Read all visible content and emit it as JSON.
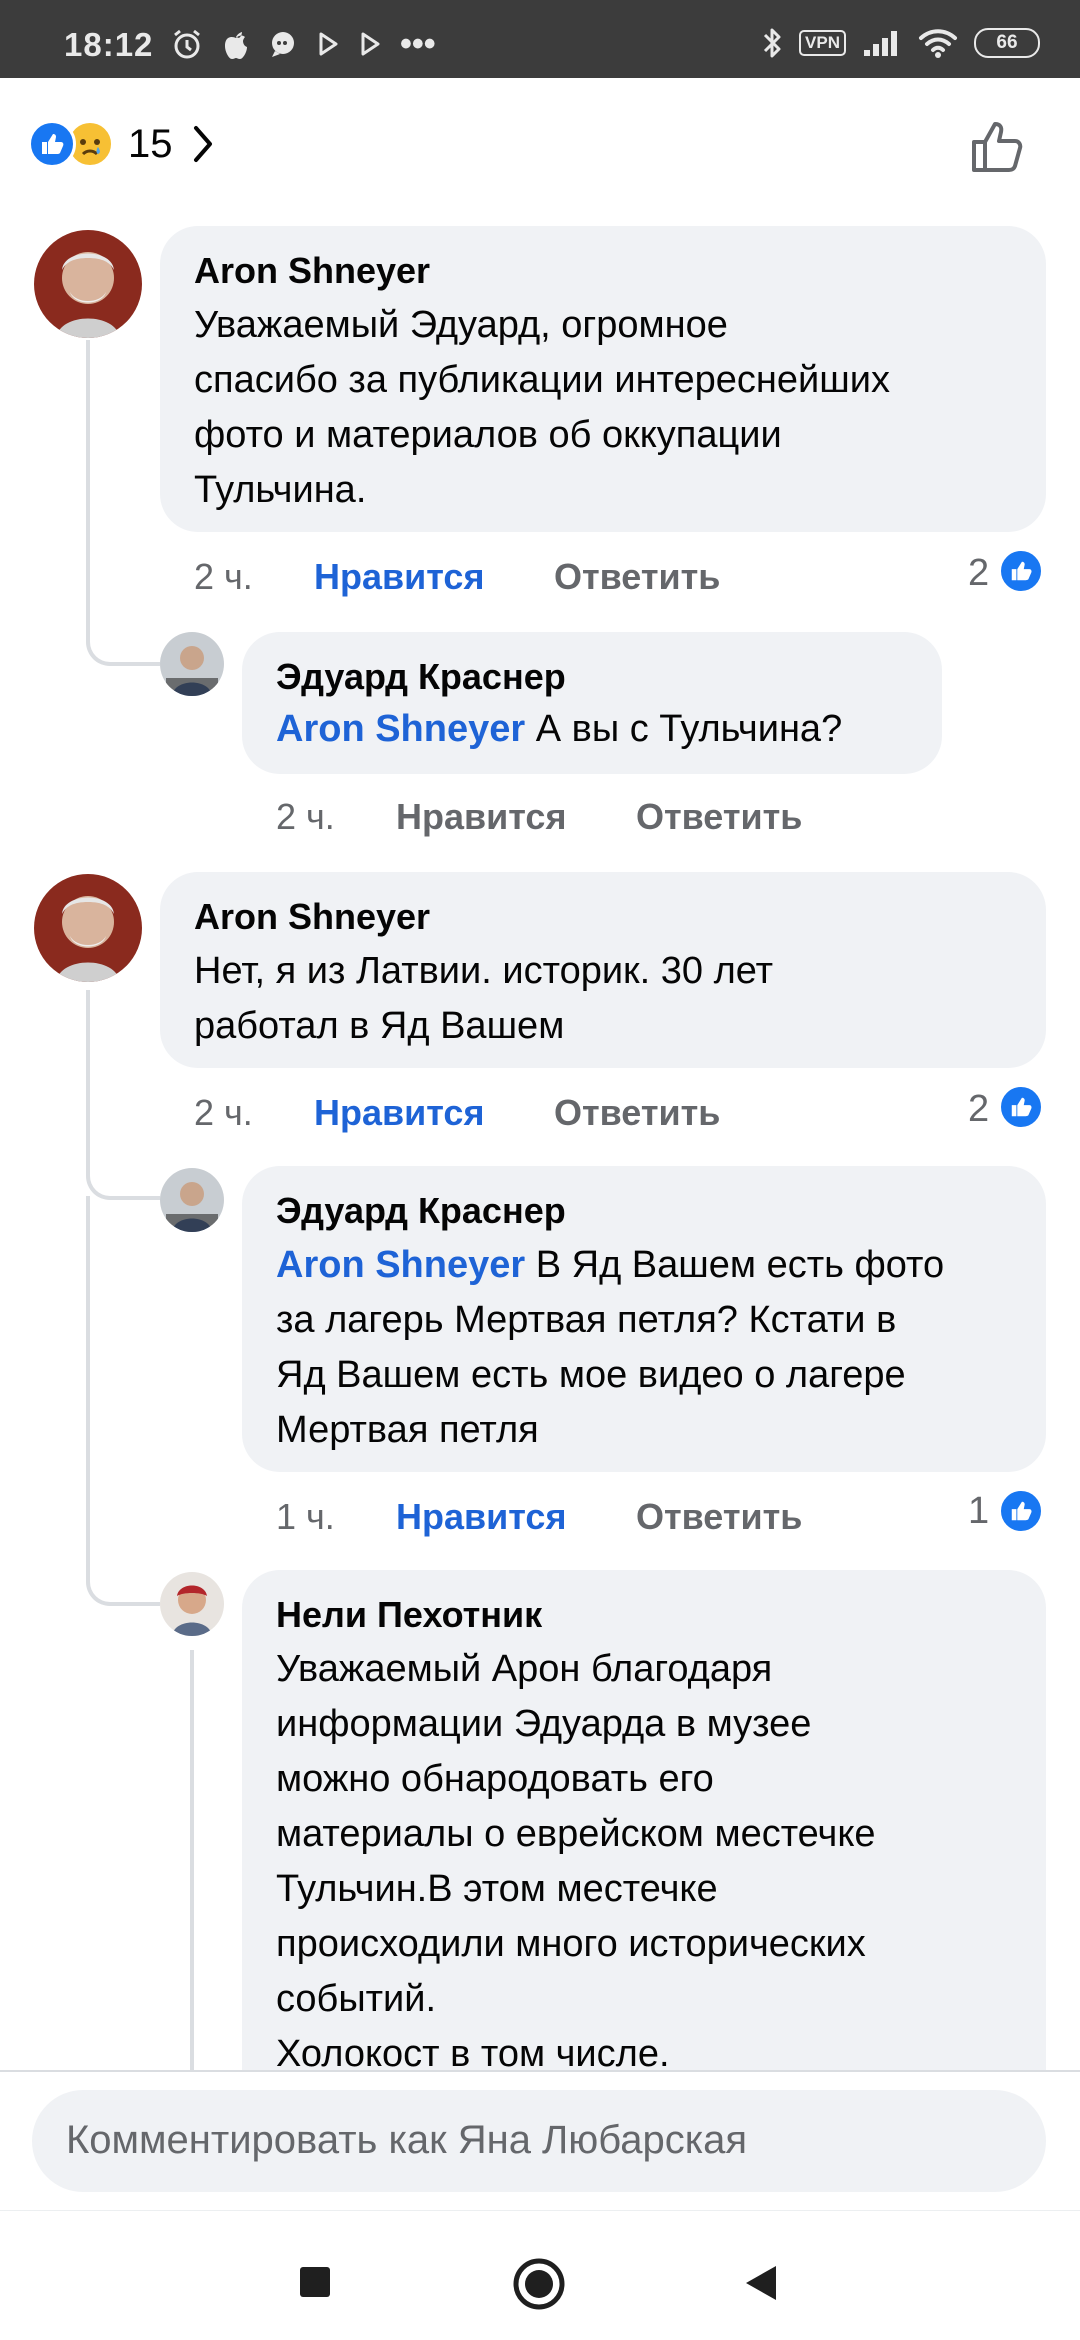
{
  "status_bar": {
    "time": "18:12",
    "vpn": "VPN",
    "battery": "66",
    "more": "•••"
  },
  "header": {
    "reaction_count": "15",
    "reaction_icons": [
      "like-icon",
      "sad-icon"
    ]
  },
  "comments": [
    {
      "author": "Aron Shneyer",
      "text": "Уважаемый Эдуард, огромное спасибо за публикации интереснейших фото и материалов  об оккупации Тульчина.",
      "lines": [
        "Уважаемый Эдуард, огромное",
        "спасибо за публикации интереснейших",
        "фото и материалов  об оккупации",
        "Тульчина."
      ],
      "time": "2 ч.",
      "like_label": "Нравится",
      "reply_label": "Ответить",
      "reactions": "2"
    },
    {
      "author": "Эдуард Краснер",
      "mention": "Aron Shneyer",
      "text": "А вы с Тульчина?",
      "time": "2 ч.",
      "like_label": "Нравится",
      "reply_label": "Ответить"
    },
    {
      "author": "Aron Shneyer",
      "lines": [
        "Нет, я из Латвии. историк. 30 лет",
        "работал в Яд Вашем"
      ],
      "time": "2 ч.",
      "like_label": "Нравится",
      "reply_label": "Ответить",
      "reactions": "2"
    },
    {
      "author": "Эдуард Краснер",
      "mention": "Aron Shneyer",
      "line1_rest": "В Яд Вашем есть фото",
      "lines": [
        "за лагерь Мертвая петля? Кстати в",
        "Яд Вашем есть мое видео о лагере",
        "Мертвая петля"
      ],
      "time": "1 ч.",
      "like_label": "Нравится",
      "reply_label": "Ответить",
      "reactions": "1"
    },
    {
      "author": "Нели Пехотник",
      "lines": [
        "Уважаемый Арон благодаря",
        "информации Эдуарда в музее",
        "можно обнародовать его",
        "материалы о еврейском местечке",
        "Тульчин.В этом местечке",
        "происходили много  исторических",
        "событий.",
        "Холокост в том числе."
      ]
    }
  ],
  "composer": {
    "placeholder": "Комментировать как Яна Любарская"
  },
  "colors": {
    "accent": "#1877f2",
    "link": "#1e63d6",
    "bubble": "#f0f2f5",
    "secondary_text": "#65676b",
    "status_bar": "#3c3c3c"
  }
}
